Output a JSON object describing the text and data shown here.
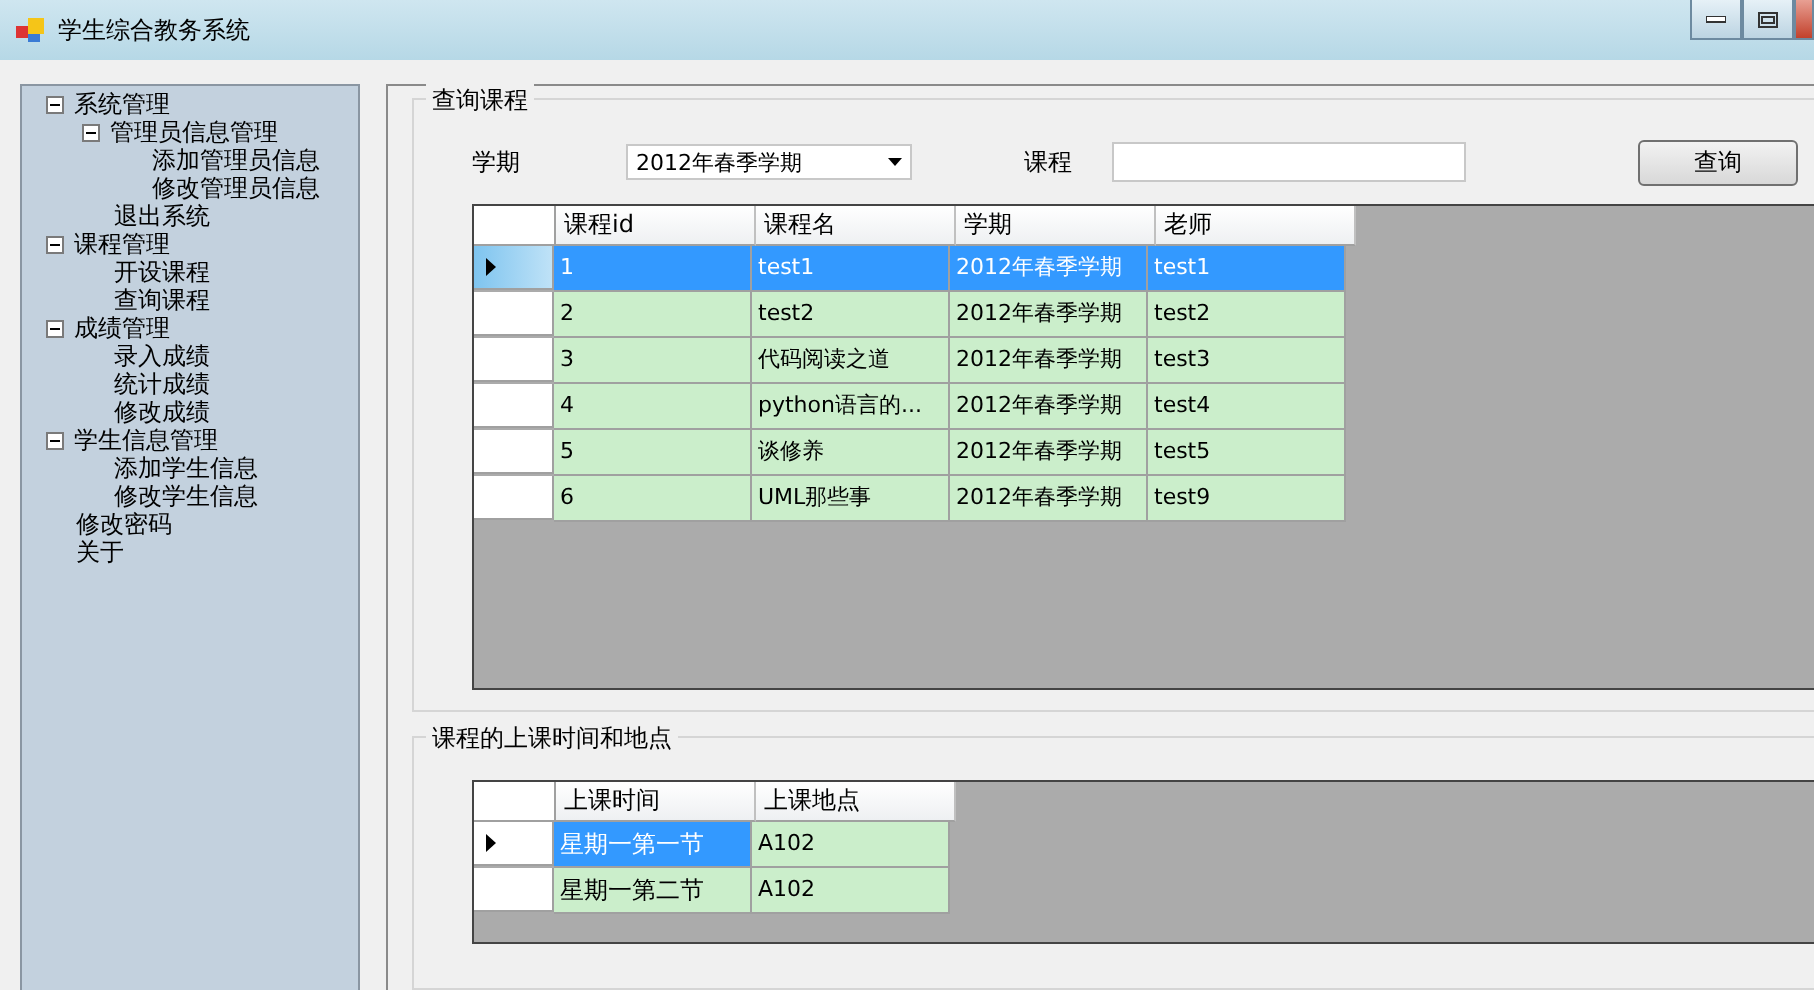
{
  "window": {
    "title": "学生综合教务系统"
  },
  "sidebar": {
    "items": [
      {
        "label": "系统管理",
        "expanded": true,
        "children": [
          {
            "label": "管理员信息管理",
            "expanded": true,
            "children": [
              {
                "label": "添加管理员信息"
              },
              {
                "label": "修改管理员信息"
              }
            ]
          },
          {
            "label": "退出系统"
          }
        ]
      },
      {
        "label": "课程管理",
        "expanded": true,
        "children": [
          {
            "label": "开设课程"
          },
          {
            "label": "查询课程"
          }
        ]
      },
      {
        "label": "成绩管理",
        "expanded": true,
        "children": [
          {
            "label": "录入成绩"
          },
          {
            "label": "统计成绩"
          },
          {
            "label": "修改成绩"
          }
        ]
      },
      {
        "label": "学生信息管理",
        "expanded": true,
        "children": [
          {
            "label": "添加学生信息"
          },
          {
            "label": "修改学生信息"
          }
        ]
      },
      {
        "label": "修改密码"
      },
      {
        "label": "关于"
      }
    ]
  },
  "query": {
    "title": "查询课程",
    "term_label": "学期",
    "term_value": "2012年春季学期",
    "course_label": "课程",
    "search_button": "查询",
    "table": {
      "columns": [
        "课程id",
        "课程名",
        "学期",
        "老师"
      ],
      "rows": [
        {
          "cells": [
            "1",
            "test1",
            "2012年春季学期",
            "test1"
          ],
          "selected": true,
          "current": true
        },
        {
          "cells": [
            "2",
            "test2",
            "2012年春季学期",
            "test2"
          ],
          "selected": false,
          "current": false
        },
        {
          "cells": [
            "3",
            "代码阅读之道",
            "2012年春季学期",
            "test3"
          ],
          "selected": false,
          "current": false
        },
        {
          "cells": [
            "4",
            "python语言的...",
            "2012年春季学期",
            "test4"
          ],
          "selected": false,
          "current": false
        },
        {
          "cells": [
            "5",
            "谈修养",
            "2012年春季学期",
            "test5"
          ],
          "selected": false,
          "current": false
        },
        {
          "cells": [
            "6",
            "UML那些事",
            "2012年春季学期",
            "test9"
          ],
          "selected": false,
          "current": false
        }
      ]
    }
  },
  "schedule": {
    "title": "课程的上课时间和地点",
    "table": {
      "columns": [
        "上课时间",
        "上课地点"
      ],
      "rows": [
        {
          "current": true,
          "cells": [
            {
              "text": "星期一第一节",
              "selected": true
            },
            {
              "text": "A102",
              "selected": false
            }
          ]
        },
        {
          "current": false,
          "cells": [
            {
              "text": "星期一第二节",
              "selected": false
            },
            {
              "text": "A102",
              "selected": false
            }
          ]
        }
      ]
    }
  }
}
